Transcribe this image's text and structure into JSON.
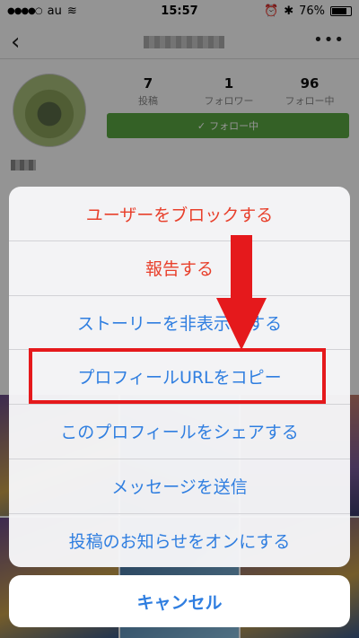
{
  "status_bar": {
    "carrier": "au",
    "time": "15:57",
    "battery": "76%"
  },
  "profile": {
    "stats": [
      {
        "value": "7",
        "label": "投稿"
      },
      {
        "value": "1",
        "label": "フォロワー"
      },
      {
        "value": "96",
        "label": "フォロー中"
      }
    ],
    "follow_button": "フォロー中"
  },
  "action_sheet": {
    "items": [
      {
        "label": "ユーザーをブロックする",
        "color": "#e8402c"
      },
      {
        "label": "報告する",
        "color": "#e8402c"
      },
      {
        "label": "ストーリーを非表示にする",
        "color": "#2f7ee0"
      },
      {
        "label": "プロフィールURLをコピー",
        "color": "#2f7ee0"
      },
      {
        "label": "このプロフィールをシェアする",
        "color": "#2f7ee0"
      },
      {
        "label": "メッセージを送信",
        "color": "#2f7ee0"
      },
      {
        "label": "投稿のお知らせをオンにする",
        "color": "#2f7ee0"
      }
    ],
    "cancel": "キャンセル"
  },
  "annotation": {
    "highlight_color": "#e5191c",
    "highlighted_item": "プロフィールURLをコピー"
  }
}
